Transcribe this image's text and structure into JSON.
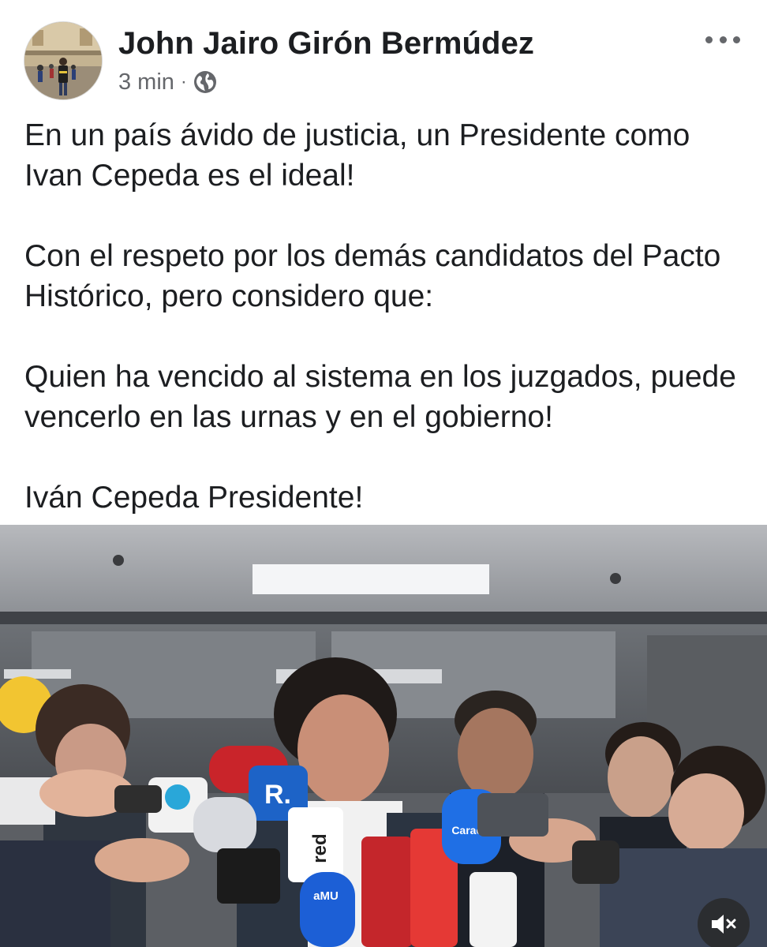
{
  "post": {
    "author": "John Jairo Girón Bermúdez",
    "time": "3 min",
    "separator": "·",
    "audience_icon": "globe-icon",
    "more_icon": "more-options-icon",
    "paragraphs": [
      "En un país ávido de justicia, un Presidente como Ivan Cepeda es el ideal!",
      "Con el respeto por los demás candidatos del Pacto Histórico, pero considero que:",
      "Quien ha vencido al sistema en los juzgados, puede vencerlo en las urnas y en el gobierno!",
      "Iván Cepeda Presidente!"
    ]
  },
  "video": {
    "mute_icon": "speaker-muted-icon",
    "mic_logos": [
      "R.",
      "red",
      "aMU",
      "Caracol"
    ]
  },
  "colors": {
    "text": "#1c1e21",
    "secondary": "#65676b",
    "background": "#ffffff"
  }
}
